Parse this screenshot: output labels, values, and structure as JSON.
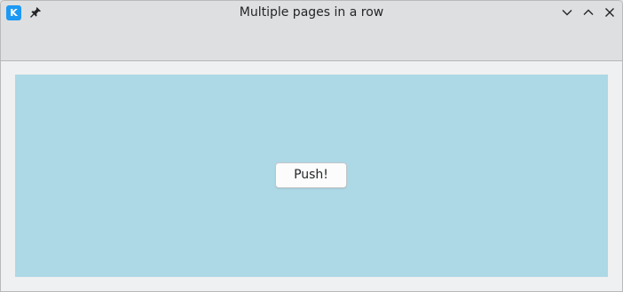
{
  "window": {
    "title": "Multiple pages in a row",
    "app_icon_glyph": "K",
    "icons": {
      "app": "kde-app-icon",
      "pin": "pin-icon",
      "minimize": "chevron-down-icon",
      "maximize": "chevron-up-icon",
      "close": "close-icon"
    }
  },
  "page": {
    "background": "#add8e6",
    "button_label": "Push!"
  },
  "colors": {
    "accent": "#1d99f3",
    "chrome": "#dedfe1",
    "content": "#eff0f1"
  }
}
